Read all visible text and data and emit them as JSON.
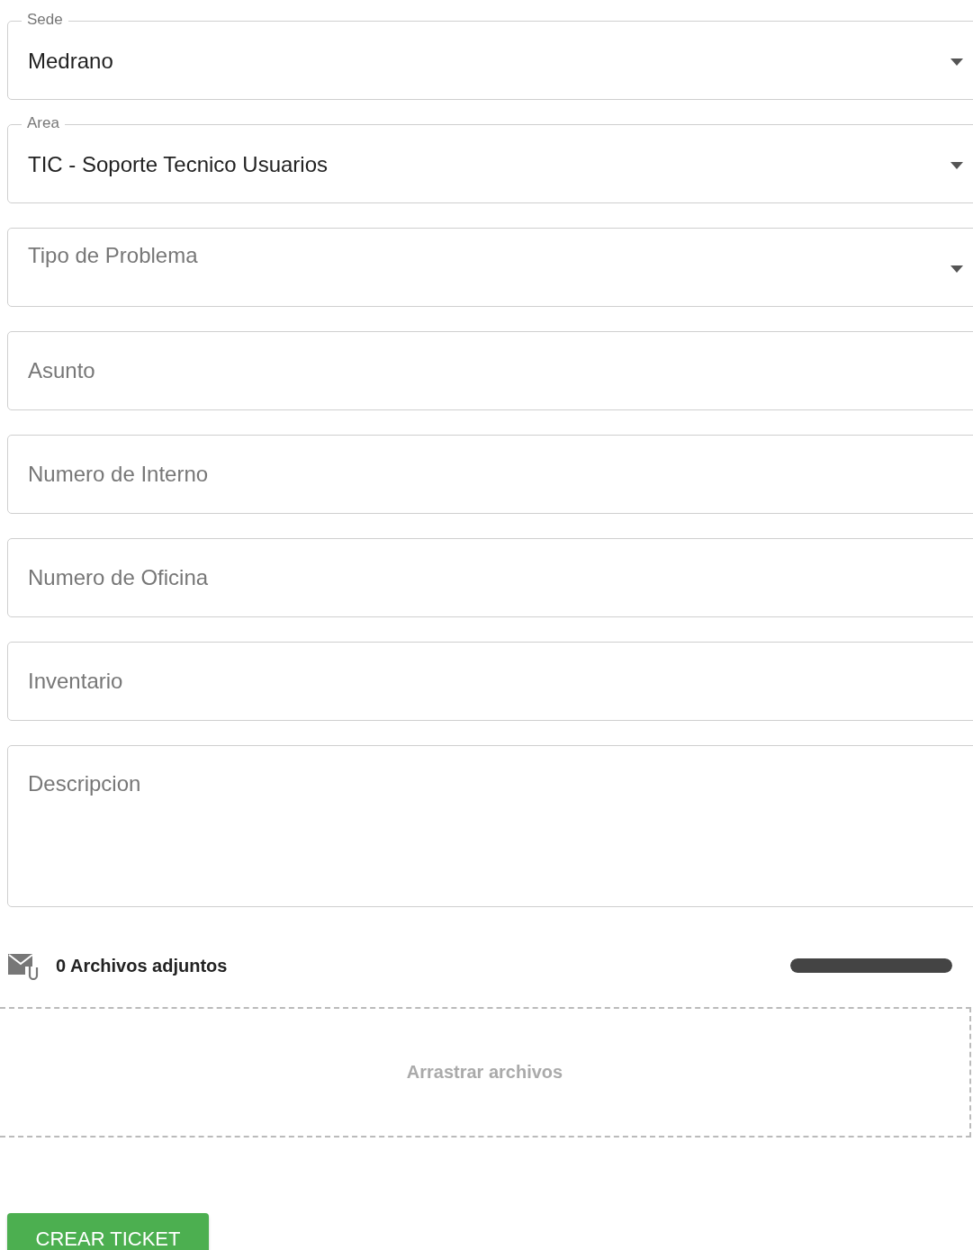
{
  "fields": [
    {
      "kind": "select",
      "label": "Sede",
      "value": "Medrano"
    },
    {
      "kind": "select",
      "label": "Area",
      "value": "TIC - Soporte Tecnico Usuarios"
    },
    {
      "kind": "select",
      "placeholder": "Tipo de Problema"
    },
    {
      "kind": "text",
      "placeholder": "Asunto"
    },
    {
      "kind": "text",
      "placeholder": "Numero de Interno"
    },
    {
      "kind": "text",
      "placeholder": "Numero de Oficina"
    },
    {
      "kind": "text",
      "placeholder": "Inventario"
    },
    {
      "kind": "textarea",
      "placeholder": "Descripcion"
    }
  ],
  "attachments": {
    "count_label": "0 Archivos adjuntos",
    "level": 1
  },
  "dropzone": {
    "label": "Arrastrar archivos"
  },
  "submit": {
    "label": "CREAR TICKET"
  }
}
